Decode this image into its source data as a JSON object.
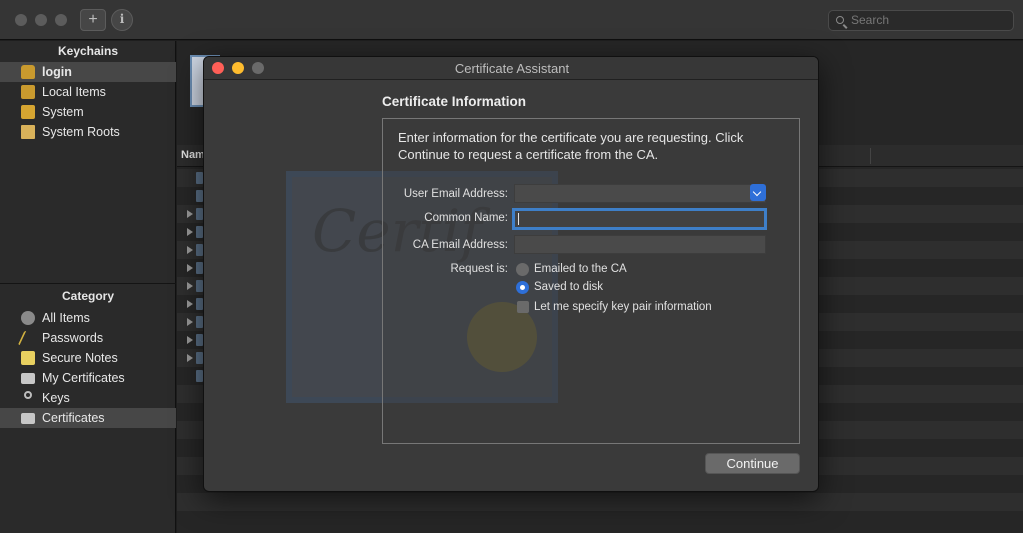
{
  "toolbar": {
    "add_glyph": "+",
    "info_glyph": "i",
    "search_placeholder": "Search"
  },
  "sidebar": {
    "keychains_header": "Keychains",
    "keychains": [
      {
        "label": "login",
        "icon": "lock-open-icon",
        "selected": true
      },
      {
        "label": "Local Items",
        "icon": "lock-open-icon"
      },
      {
        "label": "System",
        "icon": "lock-closed-icon"
      },
      {
        "label": "System Roots",
        "icon": "folder-icon"
      }
    ],
    "category_header": "Category",
    "categories": [
      {
        "label": "All Items",
        "icon": "all-items-icon"
      },
      {
        "label": "Passwords",
        "icon": "pencil-icon"
      },
      {
        "label": "Secure Notes",
        "icon": "note-icon"
      },
      {
        "label": "My Certificates",
        "icon": "certificate-icon"
      },
      {
        "label": "Keys",
        "icon": "key-icon"
      },
      {
        "label": "Certificates",
        "icon": "certificate-icon",
        "selected": true
      }
    ]
  },
  "list": {
    "name_column": "Nam"
  },
  "dialog": {
    "title": "Certificate Assistant",
    "section_title": "Certificate Information",
    "instructions": "Enter information for the certificate you are requesting. Click Continue to request a certificate from the CA.",
    "fields": {
      "user_email_label": "User Email Address:",
      "user_email_value": "",
      "common_name_label": "Common Name:",
      "common_name_value": "",
      "ca_email_label": "CA Email Address:",
      "ca_email_value": ""
    },
    "request_is_label": "Request is:",
    "options": {
      "emailed": "Emailed to the CA",
      "saved": "Saved to disk",
      "key_pair": "Let me specify key pair information"
    },
    "selected_option": "saved",
    "continue_label": "Continue"
  },
  "colors": {
    "accent": "#2e6fd8",
    "focus_ring": "#3e7fc8",
    "close": "#ff5f57",
    "minimize": "#febc2e",
    "zoom_inactive": "#6a6a6a"
  }
}
